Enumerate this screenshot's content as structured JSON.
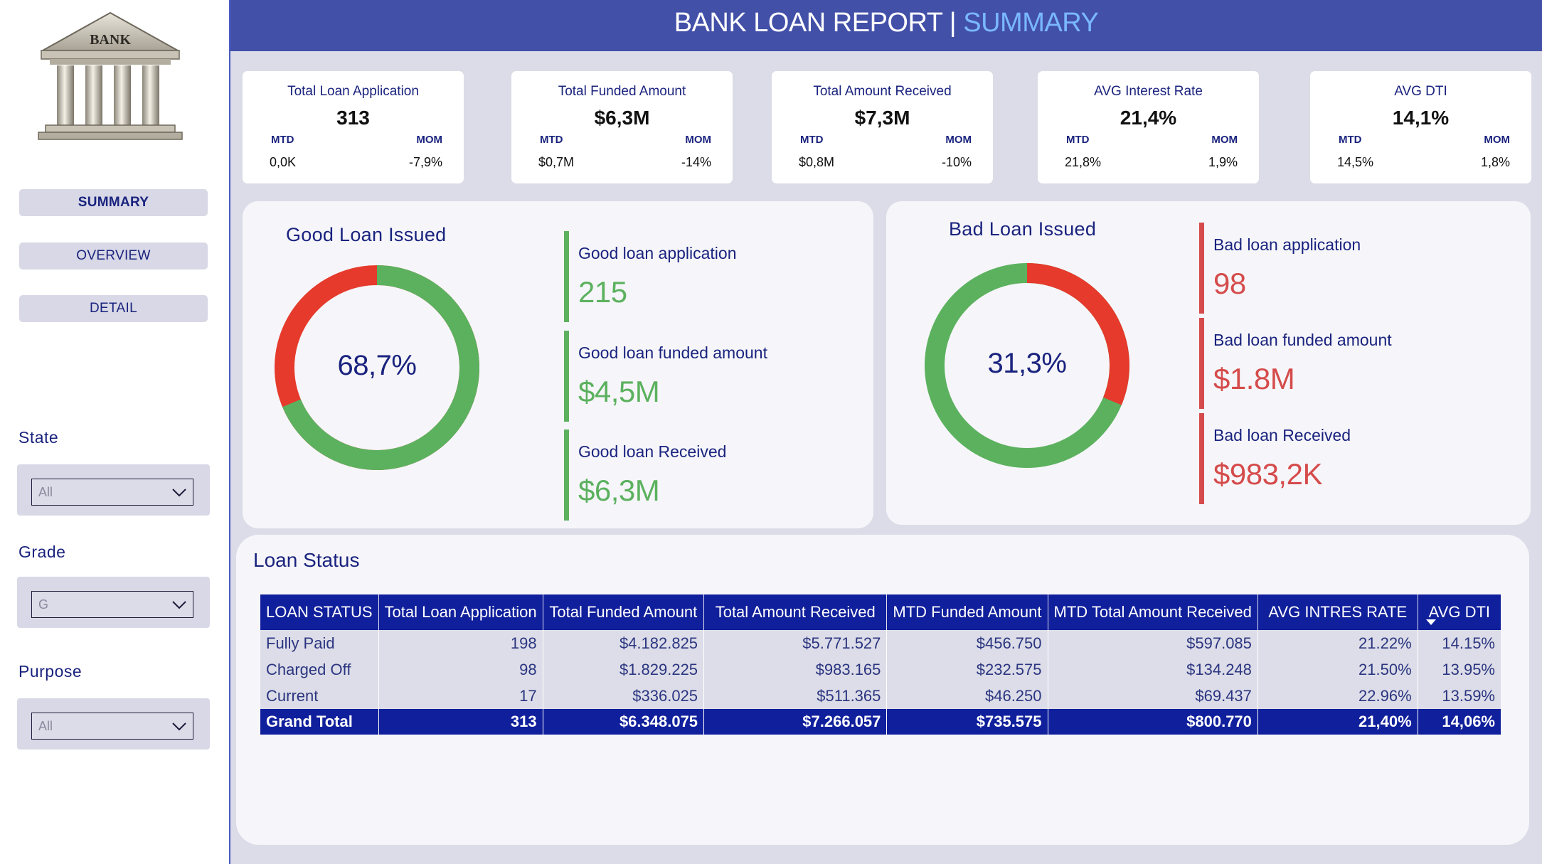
{
  "sidebar": {
    "logo_text": "BANK",
    "nav": [
      {
        "label": "SUMMARY",
        "active": true
      },
      {
        "label": "OVERVIEW",
        "active": false
      },
      {
        "label": "DETAIL",
        "active": false
      }
    ],
    "filters": [
      {
        "label": "State",
        "value": "All"
      },
      {
        "label": "Grade",
        "value": "G"
      },
      {
        "label": "Purpose",
        "value": "All"
      }
    ]
  },
  "header": {
    "title_main": "BANK LOAN REPORT | ",
    "title_accent": "SUMMARY"
  },
  "kpis": [
    {
      "title": "Total Loan Application",
      "value": "313",
      "mtd_label": "MTD",
      "mom_label": "MOM",
      "mtd": "0,0K",
      "mom": "-7,9%"
    },
    {
      "title": "Total Funded Amount",
      "value": "$6,3M",
      "mtd_label": "MTD",
      "mom_label": "MOM",
      "mtd": "$0,7M",
      "mom": "-14%"
    },
    {
      "title": "Total Amount Received",
      "value": "$7,3M",
      "mtd_label": "MTD",
      "mom_label": "MOM",
      "mtd": "$0,8M",
      "mom": "-10%"
    },
    {
      "title": "AVG Interest Rate",
      "value": "21,4%",
      "mtd_label": "MTD",
      "mom_label": "MOM",
      "mtd": "21,8%",
      "mom": "1,9%"
    },
    {
      "title": "AVG DTI",
      "value": "14,1%",
      "mtd_label": "MTD",
      "mom_label": "MOM",
      "mtd": "14,5%",
      "mom": "1,8%"
    }
  ],
  "good_loan": {
    "title": "Good Loan Issued",
    "percent_label": "68,7%",
    "percent": 0.687,
    "metrics": [
      {
        "label": "Good loan application",
        "value": "215"
      },
      {
        "label": "Good loan funded amount",
        "value": "$4,5M"
      },
      {
        "label": "Good loan Received",
        "value": "$6,3M"
      }
    ]
  },
  "bad_loan": {
    "title": "Bad Loan Issued",
    "percent_label": "31,3%",
    "percent": 0.313,
    "metrics": [
      {
        "label": "Bad loan application",
        "value": "98"
      },
      {
        "label": "Bad loan funded amount",
        "value": "$1.8M"
      },
      {
        "label": "Bad loan Received",
        "value": "$983,2K"
      }
    ]
  },
  "colors": {
    "good": "#5cb15f",
    "bad": "#e53a2c",
    "header": "#4350a8",
    "accent": "#7ab8ff",
    "table_header": "#101f9b"
  },
  "loan_status": {
    "title": "Loan Status",
    "columns": [
      "LOAN STATUS",
      "Total Loan Application",
      "Total Funded Amount",
      "Total Amount Received",
      "MTD Funded Amount",
      "MTD Total Amount Received",
      "AVG INTRES RATE",
      "AVG DTI"
    ],
    "rows": [
      [
        "Fully Paid",
        "198",
        "$4.182.825",
        "$5.771.527",
        "$456.750",
        "$597.085",
        "21.22%",
        "14.15%"
      ],
      [
        "Charged Off",
        "98",
        "$1.829.225",
        "$983.165",
        "$232.575",
        "$134.248",
        "21.50%",
        "13.95%"
      ],
      [
        "Current",
        "17",
        "$336.025",
        "$511.365",
        "$46.250",
        "$69.437",
        "22.96%",
        "13.59%"
      ]
    ],
    "total": [
      "Grand Total",
      "313",
      "$6.348.075",
      "$7.266.057",
      "$735.575",
      "$800.770",
      "21,40%",
      "14,06%"
    ]
  }
}
